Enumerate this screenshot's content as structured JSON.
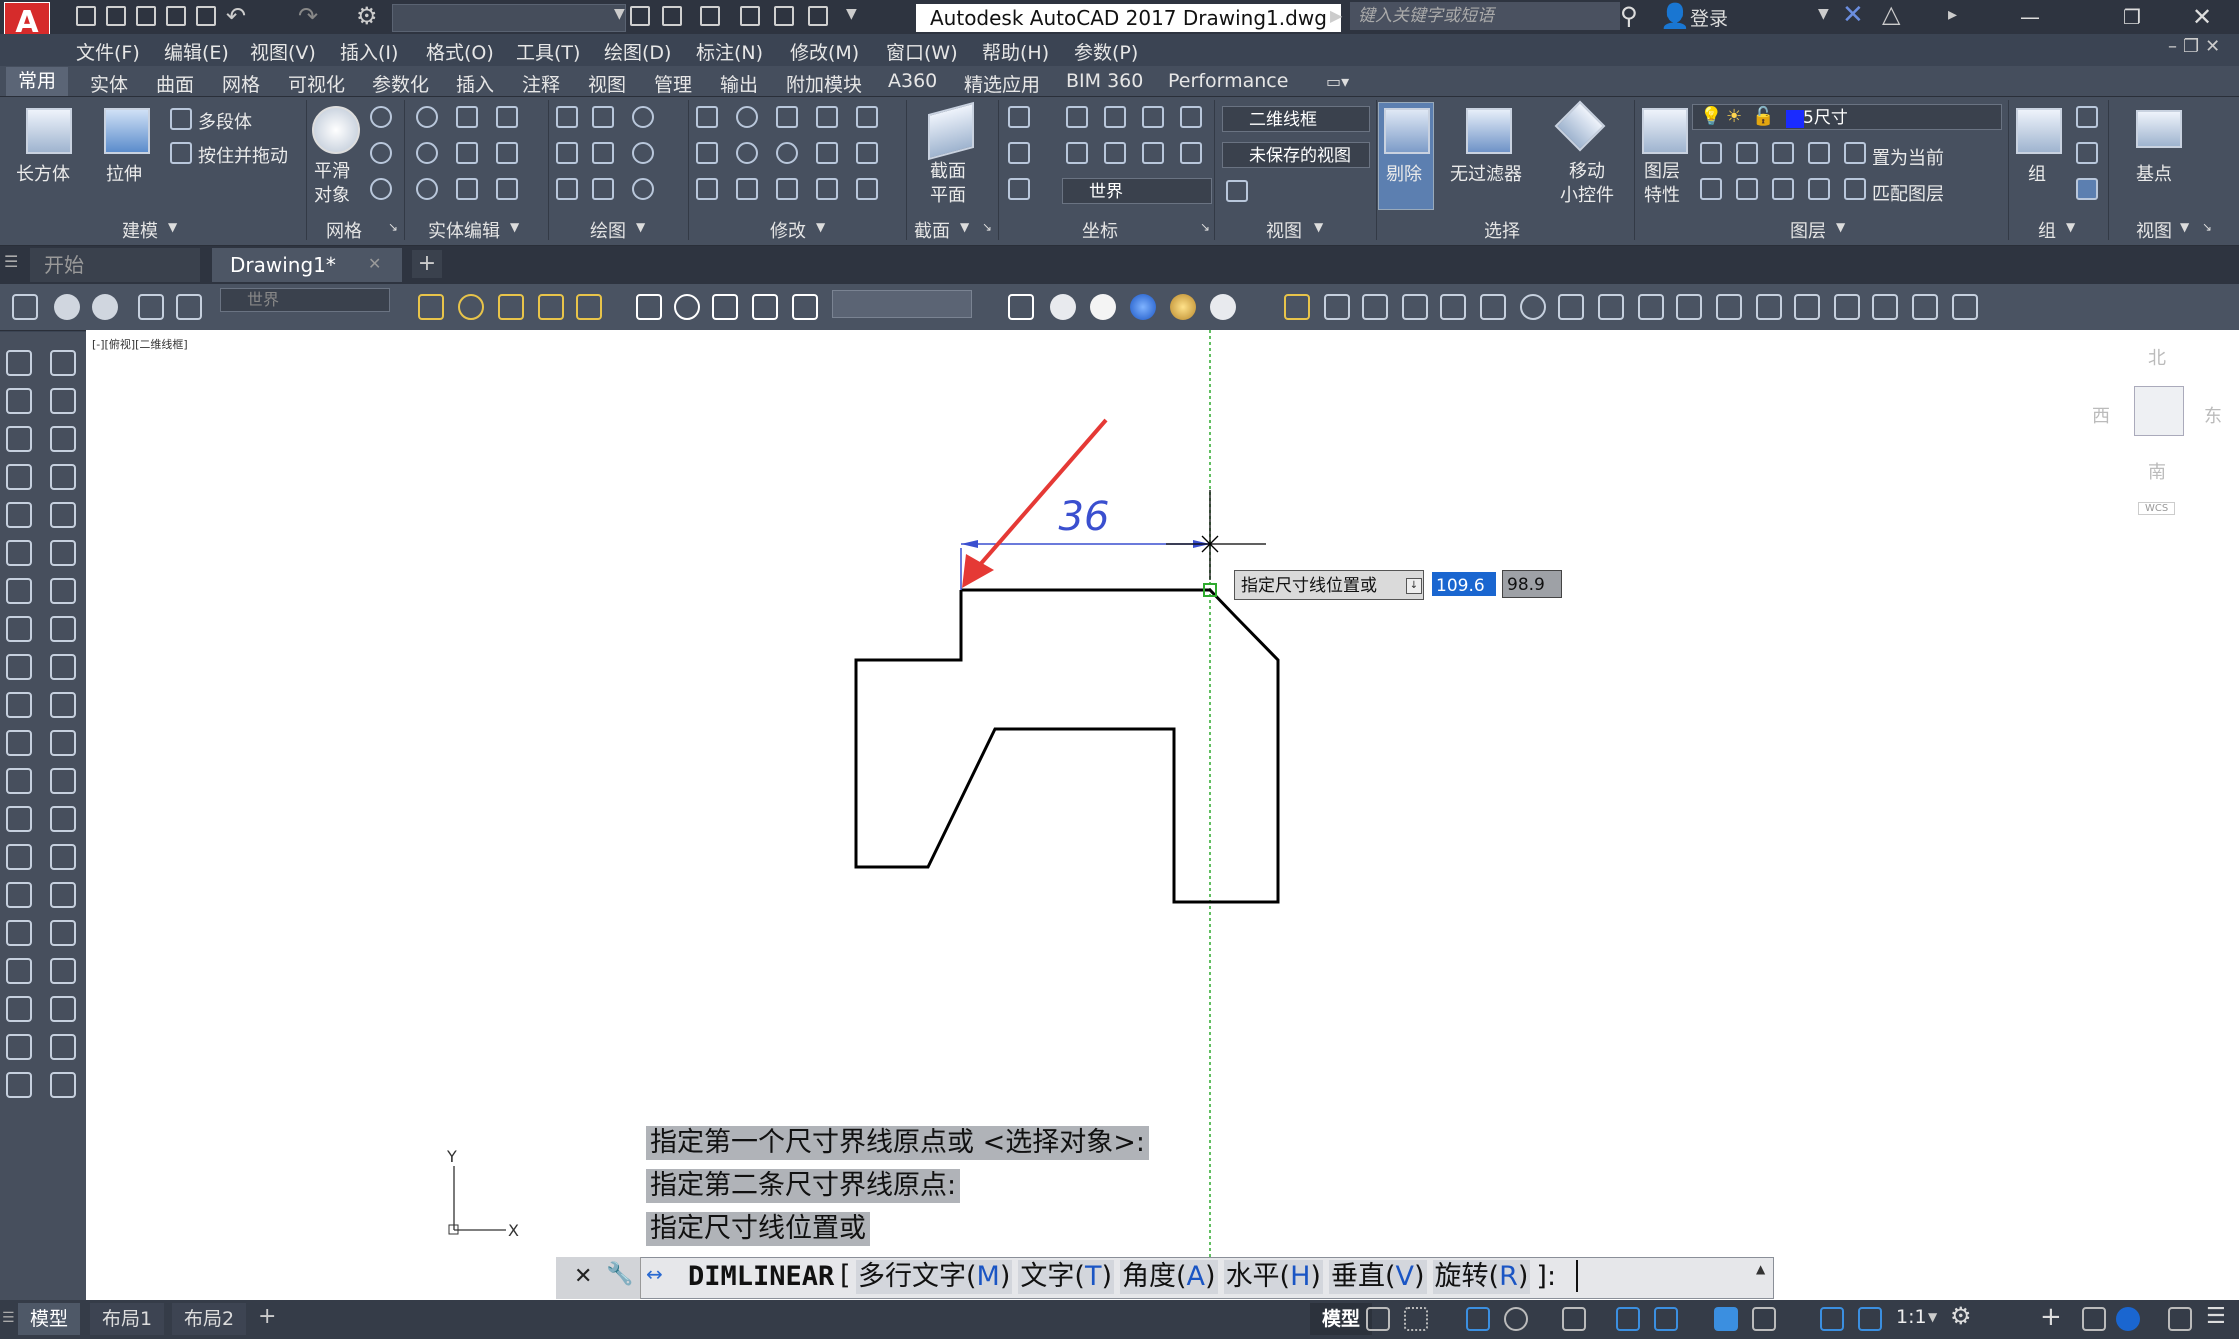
{
  "titlebar": {
    "app_logo": "A",
    "title": "Autodesk AutoCAD 2017    Drawing1.dwg",
    "search_placeholder": "键入关键字或短语",
    "login": "登录"
  },
  "menubar": [
    "文件(F)",
    "编辑(E)",
    "视图(V)",
    "插入(I)",
    "格式(O)",
    "工具(T)",
    "绘图(D)",
    "标注(N)",
    "修改(M)",
    "窗口(W)",
    "帮助(H)",
    "参数(P)"
  ],
  "ribbon_tabs": {
    "active": "常用",
    "tabs": [
      "实体",
      "曲面",
      "网格",
      "可视化",
      "参数化",
      "插入",
      "注释",
      "视图",
      "管理",
      "输出",
      "附加模块",
      "A360",
      "精选应用",
      "BIM 360",
      "Performance"
    ]
  },
  "ribbon": {
    "box_label": "长方体",
    "extrude_label": "拉伸",
    "polysolid_label": "多段体",
    "presspull_label": "按住并拖动",
    "smooth_label": "平滑\n对象",
    "section_plane_label": "截面\n平面",
    "visual_style": "二维线框",
    "saved_view": "未保存的视图",
    "ucs": "世界",
    "culling_label": "剔除",
    "no_filter_label": "无过滤器",
    "gizmo_label": "移动\n小控件",
    "layer_props_label": "图层\n特性",
    "layer_name": "5尺寸",
    "set_current_label": "置为当前",
    "match_layer_label": "匹配图层",
    "group_label": "组",
    "base_point_label": "基点",
    "panels": [
      "建模",
      "网格",
      "实体编辑",
      "绘图",
      "修改",
      "截面",
      "坐标",
      "视图",
      "选择",
      "图层",
      "组",
      "视图"
    ]
  },
  "filetabs": {
    "start": "开始",
    "drawing": "Drawing1*"
  },
  "toolbar2": {
    "ucs_dropdown": "世界"
  },
  "canvas": {
    "viewport_label": "[-][俯视][二维线框]",
    "dimension_value": "36",
    "tooltip": "指定尺寸线位置或",
    "dyn_input_1": "109.6",
    "dyn_input_2": "98.9",
    "viewcube": {
      "north": "北",
      "south": "南",
      "east": "东",
      "west": "西",
      "wcs": "WCS"
    },
    "ucs_y": "Y",
    "ucs_x": "X"
  },
  "command": {
    "history": [
      "指定第一个尺寸界线原点或 <选择对象>:",
      "指定第二条尺寸界线原点:",
      "指定尺寸线位置或"
    ],
    "command_name": "DIMLINEAR",
    "bracket_open": "[",
    "options": [
      {
        "label": "多行文字(",
        "key": "M",
        "end": ")"
      },
      {
        "label": "文字(",
        "key": "T",
        "end": ")"
      },
      {
        "label": "角度(",
        "key": "A",
        "end": ")"
      },
      {
        "label": "水平(",
        "key": "H",
        "end": ")"
      },
      {
        "label": "垂直(",
        "key": "V",
        "end": ")"
      },
      {
        "label": "旋转(",
        "key": "R",
        "end": ")"
      }
    ],
    "bracket_close": "]:"
  },
  "statusbar": {
    "tabs": [
      "模型",
      "布局1",
      "布局2"
    ],
    "model_button": "模型",
    "scale": "1:1"
  },
  "colors": {
    "accent": "#1a66d0",
    "dimension": "#3a4fcf",
    "arrow": "#e53935",
    "tracking": "#2eaa2e"
  }
}
